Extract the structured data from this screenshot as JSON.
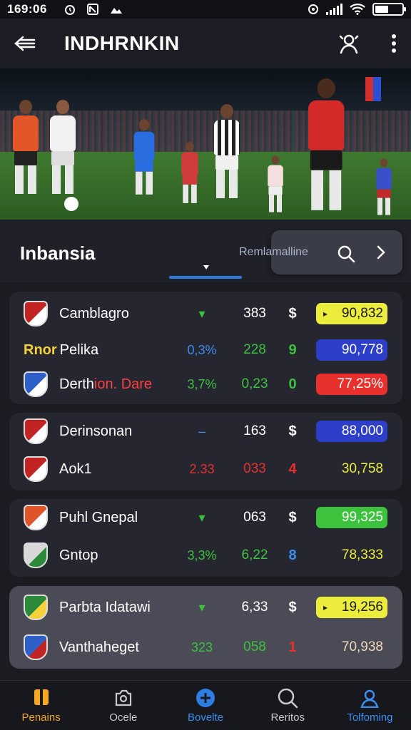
{
  "status_bar": {
    "time": "169:06"
  },
  "header": {
    "title": "INDHRNKIN"
  },
  "section": {
    "title": "Inbansia",
    "search_text": "Remlamalline"
  },
  "colors": {
    "accent_blue": "#2f7de1",
    "yellow": "#ecec3c",
    "navy": "#2d3fc8",
    "red": "#e8302c",
    "green": "#3cc23c"
  },
  "cards": [
    {
      "rows": [
        {
          "team": "Camblagro",
          "pre": "",
          "accent": "",
          "c1": "▾",
          "c2": "383",
          "c3": "$",
          "value": "90,832",
          "style": "pill-yellow"
        },
        {
          "team": "Pelika",
          "pre": "Rnor",
          "accent": "",
          "c1": "0,3%",
          "c2": "228",
          "c3": "9",
          "value": "90,778",
          "style": "pill-navy"
        },
        {
          "team": "Derth",
          "pre": "",
          "accent": "ion. Dare",
          "c1": "3,7%",
          "c2": "0,23",
          "c3": "0",
          "value": "77,25%",
          "style": "pill-red"
        }
      ]
    },
    {
      "rows": [
        {
          "team": "Derinsonan",
          "pre": "",
          "accent": "",
          "c1": "‒",
          "c2": "163",
          "c3": "$",
          "value": "88,000",
          "style": "pill-navy"
        },
        {
          "team": "Aok1",
          "pre": "",
          "accent": "",
          "c1": "2.33",
          "c2": "033",
          "c3": "4",
          "value": "30,758",
          "style": "plain-yellow"
        }
      ]
    },
    {
      "rows": [
        {
          "team": "Puhl Gnepal",
          "pre": "",
          "accent": "",
          "c1": "▾",
          "c2": "063",
          "c3": "$",
          "value": "99,325",
          "style": "pill-green"
        },
        {
          "team": "Gntop",
          "pre": "",
          "accent": "",
          "c1": "3,3%",
          "c2": "6,22",
          "c3": "8",
          "value": "78,333",
          "style": "plain-yellow"
        }
      ]
    },
    {
      "rows": [
        {
          "team": "Parbta Idatawi",
          "pre": "",
          "accent": "",
          "c1": "▾",
          "c2": "6,33",
          "c3": "$",
          "value": "19,256",
          "style": "pill-yellow"
        },
        {
          "team": "Vanthaheget",
          "pre": "",
          "accent": "",
          "c1": "323",
          "c2": "058",
          "c3": "1",
          "value": "70,938",
          "style": "plain-peach"
        }
      ]
    }
  ],
  "bottom_nav": [
    {
      "label": "Penains",
      "icon": "trophy-icon"
    },
    {
      "label": "Ocele",
      "icon": "camera-icon"
    },
    {
      "label": "Bovelte",
      "icon": "plus-circle-icon"
    },
    {
      "label": "Reritos",
      "icon": "search-icon"
    },
    {
      "label": "Tolfoming",
      "icon": "profile-icon"
    }
  ]
}
